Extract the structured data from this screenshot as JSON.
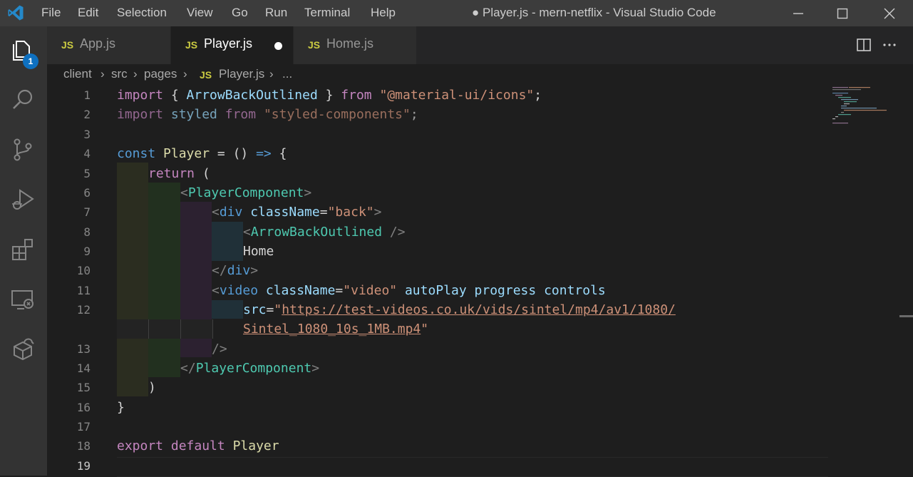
{
  "titlebar": {
    "menu": [
      "File",
      "Edit",
      "Selection",
      "View",
      "Go",
      "Run",
      "Terminal",
      "Help"
    ],
    "window_title": "● Player.js - mern-netflix - Visual Studio Code"
  },
  "activity_bar": {
    "explorer_badge": "1",
    "icons": [
      "files-icon",
      "search-icon",
      "source-control-icon",
      "run-debug-icon",
      "extensions-icon",
      "remote-explorer-icon",
      "docker-icon"
    ]
  },
  "tabs": [
    {
      "icon": "JS",
      "label": "App.js",
      "active": false
    },
    {
      "icon": "JS",
      "label": "Player.js",
      "active": true,
      "dirty": true
    },
    {
      "icon": "JS",
      "label": "Home.js",
      "active": false
    }
  ],
  "breadcrumb": {
    "parts": [
      "client",
      "src",
      "pages"
    ],
    "file_icon": "JS",
    "file": "Player.js",
    "ellipsis": "..."
  },
  "editor": {
    "line_numbers": [
      "1",
      "2",
      "3",
      "4",
      "5",
      "6",
      "7",
      "8",
      "9",
      "10",
      "11",
      "12",
      "13",
      "14",
      "15",
      "16",
      "17",
      "18",
      "19"
    ],
    "current_line": "19",
    "lines": {
      "l1": {
        "a": "import",
        "b": " { ",
        "c": "ArrowBackOutlined",
        "d": " } ",
        "e": "from",
        "f": " ",
        "g": "\"@material-ui/icons\"",
        "h": ";"
      },
      "l2": {
        "a": "import",
        "b": " styled ",
        "c": "from",
        "d": " ",
        "e": "\"styled-components\"",
        "f": ";"
      },
      "l4": {
        "a": "const",
        "b": " ",
        "c": "Player",
        "d": " = () ",
        "e": "=>",
        "f": " {"
      },
      "l5": {
        "a": "return",
        "b": " ("
      },
      "l6": {
        "a": "<",
        "b": "PlayerComponent",
        "c": ">"
      },
      "l7": {
        "a": "<",
        "b": "div",
        "c": " ",
        "d": "className",
        "e": "=",
        "f": "\"back\"",
        "g": ">"
      },
      "l8": {
        "a": "<",
        "b": "ArrowBackOutlined",
        "c": " ",
        "d": "/>"
      },
      "l9": {
        "a": "Home"
      },
      "l10": {
        "a": "</",
        "b": "div",
        "c": ">"
      },
      "l11": {
        "a": "<",
        "b": "video",
        "c": " ",
        "d": "className",
        "e": "=",
        "f": "\"video\"",
        "g": " ",
        "h": "autoPlay",
        "i": " ",
        "j": "progress",
        "k": " ",
        "l": "controls"
      },
      "l12": {
        "a": "src",
        "b": "=",
        "c": "\"",
        "d": "https://test-videos.co.uk/vids/sintel/mp4/av1/1080/"
      },
      "l12b": {
        "a": "Sintel_1080_10s_1MB.mp4",
        "b": "\""
      },
      "l13": {
        "a": "/>"
      },
      "l14": {
        "a": "</",
        "b": "PlayerComponent",
        "c": ">"
      },
      "l15": {
        "a": ")"
      },
      "l16": {
        "a": "}"
      },
      "l18": {
        "a": "export",
        "b": " ",
        "c": "default",
        "d": " ",
        "e": "Player"
      }
    }
  },
  "colors": {
    "title_bar": "#3c3c3c",
    "activity_bar": "#333333",
    "editor_bg": "#1e1e1e",
    "badge": "#0e70c0",
    "js_icon": "#cbcb41"
  }
}
